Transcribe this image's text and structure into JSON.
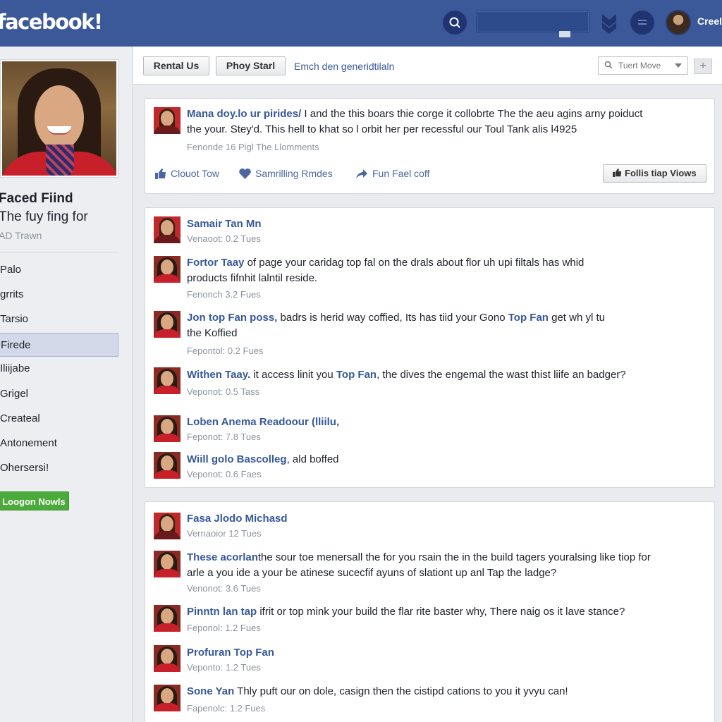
{
  "colors": {
    "brand_blue": "#3b5998",
    "link_blue": "#365899",
    "green_button": "#4bab3a"
  },
  "header": {
    "logo": "facebook!",
    "user_name": "Creel",
    "icons": [
      "search-icon",
      "shield-icon",
      "globe-icon"
    ]
  },
  "sidebar": {
    "profile_name": "Faced Fiind",
    "profile_subtitle": "The fuy fing for",
    "profile_tag": "AD Trawn",
    "items": [
      {
        "label": "Palo",
        "active": false
      },
      {
        "label": "grrits",
        "active": false
      },
      {
        "label": "Tarsio",
        "active": false
      },
      {
        "label": "Firede",
        "active": true
      },
      {
        "label": "Iliijabe",
        "active": false
      },
      {
        "label": "Grigel",
        "active": false
      },
      {
        "label": "Createal",
        "active": false
      },
      {
        "label": "Antonement",
        "active": false
      },
      {
        "label": "Ohersersi!",
        "active": false
      }
    ],
    "button_label": "Loogon Nowls"
  },
  "toolbar": {
    "button1": "Rental Us",
    "button2": "Phoy Starl",
    "link": "Emch den generidtilaln",
    "select_value": "Tuert Move",
    "plus_label": "+"
  },
  "top_post": {
    "author": "Mana doy.lo ur pirides/",
    "text1": " I and the this boars thie corge it collobrte The the aeu agins arny poiduct",
    "text2": "the your. Stey'd. This hell to khat so l orbit her per recessful our Toul Tank alis l4925",
    "meta": "Fenonde 16 Pigl The Llomments",
    "actions": [
      "Clouot Tow",
      "Samrilling Rmdes",
      "Fun Fael coff"
    ],
    "follow_label": "Follis tiap Viows"
  },
  "card2": {
    "posts": [
      {
        "name": "Samair Tan Mn",
        "text": "",
        "text2": "",
        "meta": "Venaoot: 0.2 Tues"
      },
      {
        "name": "Fortor Taay",
        "text": " of page your caridag top fal on the drals about flor uh upi filtals has whid",
        "text2": "products fifnhit lalntil reside.",
        "meta": "Fenonch 3.2 Fues"
      },
      {
        "name": "Jon top Fan poss,",
        "text": " badrs is herid way coffied, Its has tiid your Gono ",
        "tf": "Top Fan",
        "text_b": " get wh yl tu",
        "text2": "the Koffied",
        "meta": "Fepontol: 0.2 Fues"
      },
      {
        "name": "Withen Taay.",
        "text": " it access linit you ",
        "tf": "Top Fan",
        "text_b": ", the dives the engemal the wast thist liife an badger?",
        "text2": "",
        "meta": "Veponot: 0.5 Tass"
      },
      {
        "name": "Loben Anema Readoour (lliilu,",
        "text": "",
        "text2": "",
        "meta": "Feponot: 7.8 Tues"
      },
      {
        "name": "Wiill golo Bascolleg",
        "text": ", ald boffed",
        "text2": "",
        "meta": "Veponot: 0.6 Faes"
      }
    ]
  },
  "card3": {
    "posts": [
      {
        "name": "Fasa Jlodo Michasd",
        "text": "",
        "text2": "",
        "meta": "Vernaoior 12 Tues"
      },
      {
        "name": "These acorlan",
        "text": "the sour toe menersall the for you rsain the in the build tagers youralsing like tiop for",
        "text2": "arle a you ide a your be atinese sucecfif ayuns of slationt up anl Tap the ladge?",
        "meta": "Venonot: 3.6 Tues"
      },
      {
        "name": "Pinntn lan tap",
        "text": " ifrit or top mink your build the flar rite baster why, There naig os it lave stance?",
        "text2": "",
        "meta": "Feponol: 1.2 Fues"
      },
      {
        "name": "Profuran Top Fan",
        "text": "",
        "text2": "",
        "meta": "Veponto: 1.2 Tues"
      },
      {
        "name": "Sone Yan",
        "text": " Thly puft our on dole, casign then the cistipd cations to you it yvyu can!",
        "text2": "",
        "meta": "Fapenolc: 1.2 Fues"
      }
    ]
  }
}
